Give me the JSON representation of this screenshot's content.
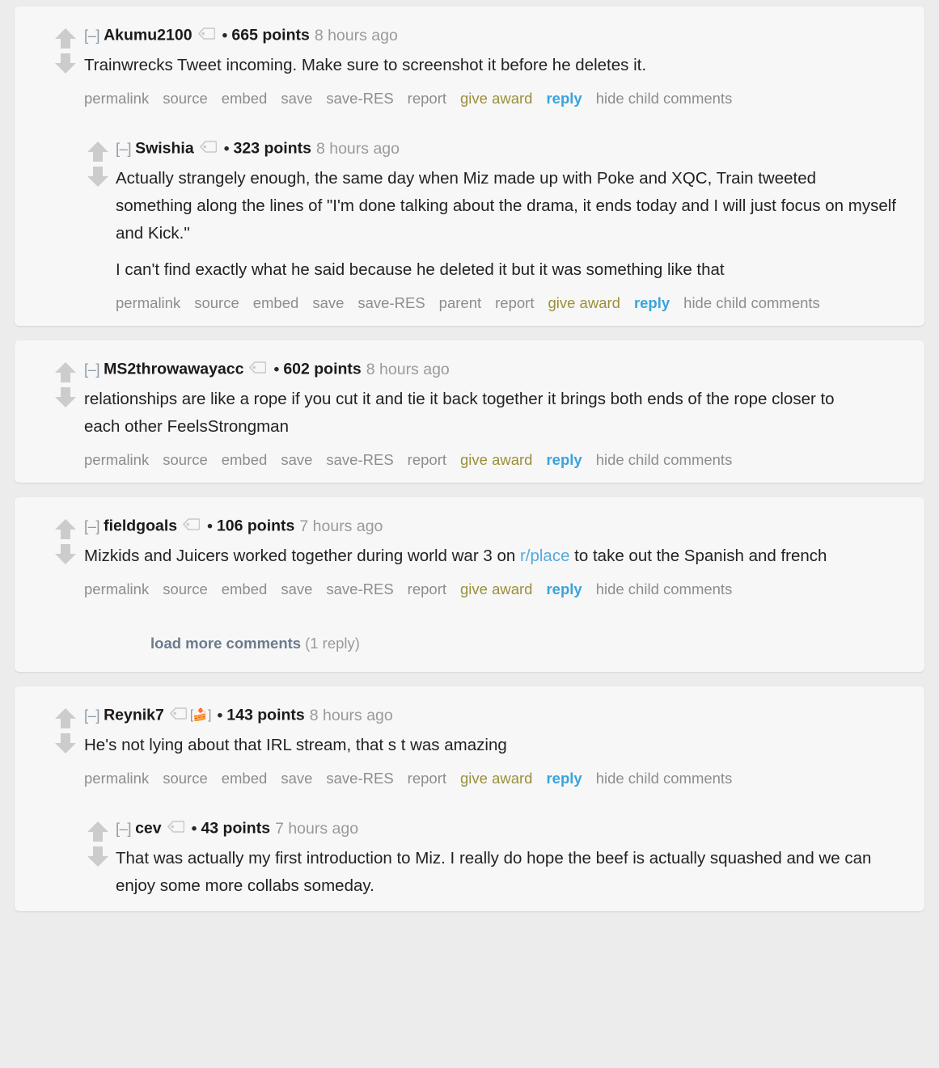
{
  "page": {
    "background": "#ececec",
    "card_background": "#f7f7f7",
    "accent_reply": "#3aa3dd",
    "accent_award": "#9b8f39",
    "accent_link": "#55aadd",
    "muted": "#8d8d8d"
  },
  "icons": {
    "upvote": "upvote-arrow-icon",
    "downvote": "downvote-arrow-icon",
    "usertag": "user-tag-icon",
    "cakeday": "cake-day-icon",
    "collapse": "[–]"
  },
  "actions": {
    "permalink": "permalink",
    "source": "source",
    "embed": "embed",
    "save": "save",
    "save_res": "save-RES",
    "parent": "parent",
    "report": "report",
    "give_award": "give award",
    "reply": "reply",
    "hide_child_comments": "hide child comments"
  },
  "load_more": {
    "label": "load more comments",
    "count": "(1 reply)"
  },
  "comments": [
    {
      "id": "akumu2100",
      "author": "Akumu2100",
      "has_tag": true,
      "has_cake": false,
      "points": "665 points",
      "age": "8 hours ago",
      "paragraphs": [
        "Trainwrecks Tweet incoming. Make sure to screenshot it before he deletes it."
      ],
      "replies": [
        {
          "id": "swishia",
          "author": "Swishia",
          "has_tag": true,
          "has_cake": false,
          "points": "323 points",
          "age": "8 hours ago",
          "paragraphs": [
            "Actually strangely enough, the same day when Miz made up with Poke and XQC, Train tweeted something along the lines of \"I'm done talking about the drama, it ends today and I will just focus on myself and Kick.\"",
            "I can't find exactly what he said because he deleted it but it was something like that"
          ]
        }
      ]
    },
    {
      "id": "ms2throwawayacc",
      "author": "MS2throwawayacc",
      "has_tag": true,
      "has_cake": false,
      "points": "602 points",
      "age": "8 hours ago",
      "paragraphs": [
        "relationships are like a rope if you cut it and tie it back together it brings both ends of the rope closer to each other FeelsStrongman"
      ],
      "replies": []
    },
    {
      "id": "fieldgoals",
      "author": "fieldgoals",
      "has_tag": true,
      "has_cake": false,
      "points": "106 points",
      "age": "7 hours ago",
      "body_pre": "Mizkids and Juicers worked together during world war 3 on ",
      "body_link": "r/place",
      "body_post": " to take out the Spanish and french",
      "paragraphs": [],
      "replies": [],
      "show_load_more": true
    },
    {
      "id": "reynik7",
      "author": "Reynik7",
      "has_tag": true,
      "has_cake": true,
      "points": "143 points",
      "age": "8 hours ago",
      "paragraphs": [
        "He's not lying about that IRL stream, that s   t was amazing"
      ],
      "replies": [
        {
          "id": "cev",
          "author": "cev",
          "has_tag": true,
          "has_cake": false,
          "points": "43 points",
          "age": "7 hours ago",
          "paragraphs": [
            "That was actually my first introduction to Miz. I really do hope the beef is actually squashed and we can enjoy some more collabs someday."
          ]
        }
      ]
    }
  ]
}
